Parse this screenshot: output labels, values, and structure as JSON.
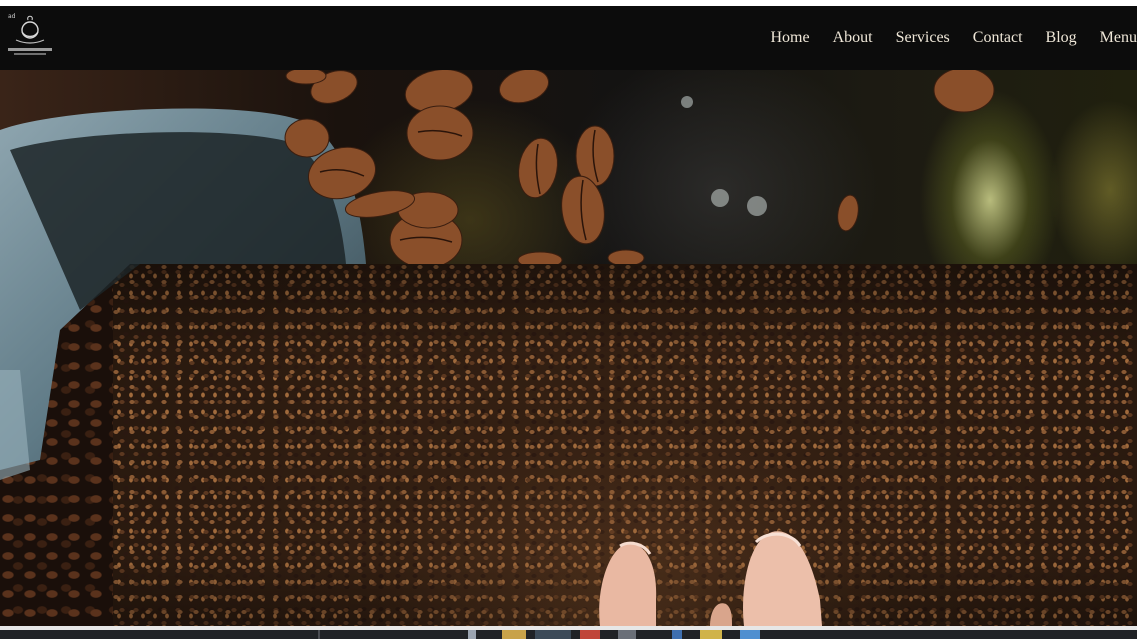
{
  "navbar": {
    "logo_icon": "coffee-logo-icon",
    "items": [
      {
        "label": "Home"
      },
      {
        "label": "About"
      },
      {
        "label": "Services"
      },
      {
        "label": "Contact"
      },
      {
        "label": "Blog"
      },
      {
        "label": "Menu"
      }
    ]
  },
  "hero": {
    "image": "coffee-beans-photo",
    "subjects": [
      "tilted-jar-icon",
      "falling-beans",
      "bean-bed",
      "hands"
    ]
  },
  "taskbar": {
    "icons": [
      "app-icon",
      "app-icon",
      "app-icon",
      "app-icon",
      "app-icon",
      "app-icon",
      "app-icon",
      "app-icon"
    ]
  },
  "colors": {
    "navbar_bg": "#0c0c0c",
    "nav_text": "#efe7d8",
    "taskbar_bg": "#202226"
  }
}
